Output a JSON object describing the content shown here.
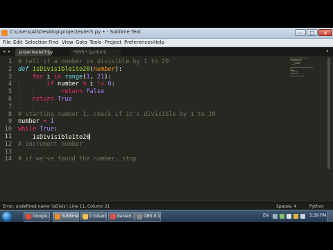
{
  "window": {
    "title": "C:\\Users\\Ali\\Desktop\\projecteuler5.py • - Sublime Text"
  },
  "menu": [
    "File",
    "Edit",
    "Selection",
    "Find",
    "View",
    "Goto",
    "Tools",
    "Project",
    "Preferences",
    "Help"
  ],
  "tabs": [
    {
      "label": "projecteuler5.py",
      "active": true
    },
    {
      "label": "*REPL* [python]",
      "active": false
    }
  ],
  "editor": {
    "lines": [
      {
        "n": "1",
        "tokens": [
          {
            "t": "# tell if a number is divisible by 1 to 20",
            "c": "cmt"
          }
        ]
      },
      {
        "n": "2",
        "tokens": [
          {
            "t": "def",
            "c": "def"
          },
          {
            "t": " "
          },
          {
            "t": "isDivisible1to20",
            "c": "fn"
          },
          {
            "t": "("
          },
          {
            "t": "number",
            "c": "param"
          },
          {
            "t": "):"
          }
        ]
      },
      {
        "n": "3",
        "tokens": [
          {
            "t": "    "
          },
          {
            "t": "for",
            "c": "kw"
          },
          {
            "t": " i "
          },
          {
            "t": "in",
            "c": "kw"
          },
          {
            "t": " "
          },
          {
            "t": "range",
            "c": "builtin"
          },
          {
            "t": "("
          },
          {
            "t": "1",
            "c": "num"
          },
          {
            "t": ", "
          },
          {
            "t": "21",
            "c": "num"
          },
          {
            "t": "):"
          }
        ]
      },
      {
        "n": "4",
        "tokens": [
          {
            "t": "        "
          },
          {
            "t": "if",
            "c": "kw"
          },
          {
            "t": " number "
          },
          {
            "t": "%",
            "c": "kw"
          },
          {
            "t": " i "
          },
          {
            "t": "!=",
            "c": "kw"
          },
          {
            "t": " "
          },
          {
            "t": "0",
            "c": "num"
          },
          {
            "t": ":"
          }
        ]
      },
      {
        "n": "5",
        "tokens": [
          {
            "t": "            "
          },
          {
            "t": "return",
            "c": "kw"
          },
          {
            "t": " "
          },
          {
            "t": "False",
            "c": "const"
          }
        ]
      },
      {
        "n": "6",
        "tokens": [
          {
            "t": "    "
          },
          {
            "t": "return",
            "c": "kw"
          },
          {
            "t": " "
          },
          {
            "t": "True",
            "c": "const"
          }
        ]
      },
      {
        "n": "7",
        "tokens": []
      },
      {
        "n": "8",
        "tokens": [
          {
            "t": "# starting number 1, check if it's divisible by 1 to 20",
            "c": "cmt"
          }
        ]
      },
      {
        "n": "9",
        "tokens": [
          {
            "t": "number "
          },
          {
            "t": "=",
            "c": "kw"
          },
          {
            "t": " "
          },
          {
            "t": "1",
            "c": "num"
          }
        ]
      },
      {
        "n": "10",
        "tokens": [
          {
            "t": "while",
            "c": "kw"
          },
          {
            "t": " "
          },
          {
            "t": "True",
            "c": "const"
          },
          {
            "t": ":"
          }
        ]
      },
      {
        "n": "11",
        "tokens": [
          {
            "t": "    isDivisible1to20"
          }
        ],
        "caret": true
      },
      {
        "n": "12",
        "tokens": [
          {
            "t": "# increment number",
            "c": "cmt"
          }
        ]
      },
      {
        "n": "13",
        "tokens": []
      },
      {
        "n": "14",
        "tokens": [
          {
            "t": "# if we've found the number, stop",
            "c": "cmt"
          }
        ]
      }
    ]
  },
  "status": {
    "message": "Error: undefined name 'isDivis'; Line 11, Column 21",
    "indentation": "Spaces: 4",
    "syntax": "Python"
  },
  "taskbar": {
    "buttons": [
      {
        "label": "Google...",
        "icon_color": "#e04a3c",
        "active": false
      },
      {
        "label": "Sublime...",
        "icon_color": "#f18b2b",
        "active": true
      },
      {
        "label": "C:\\Users...",
        "icon_color": "#f2c14e",
        "active": false
      },
      {
        "label": "Kalveri...",
        "icon_color": "#d9534f",
        "active": false
      },
      {
        "label": "OBS 0.1...",
        "icon_color": "#8a8a8a",
        "active": false
      }
    ],
    "language": "EN",
    "clock": "5:39 PM"
  }
}
